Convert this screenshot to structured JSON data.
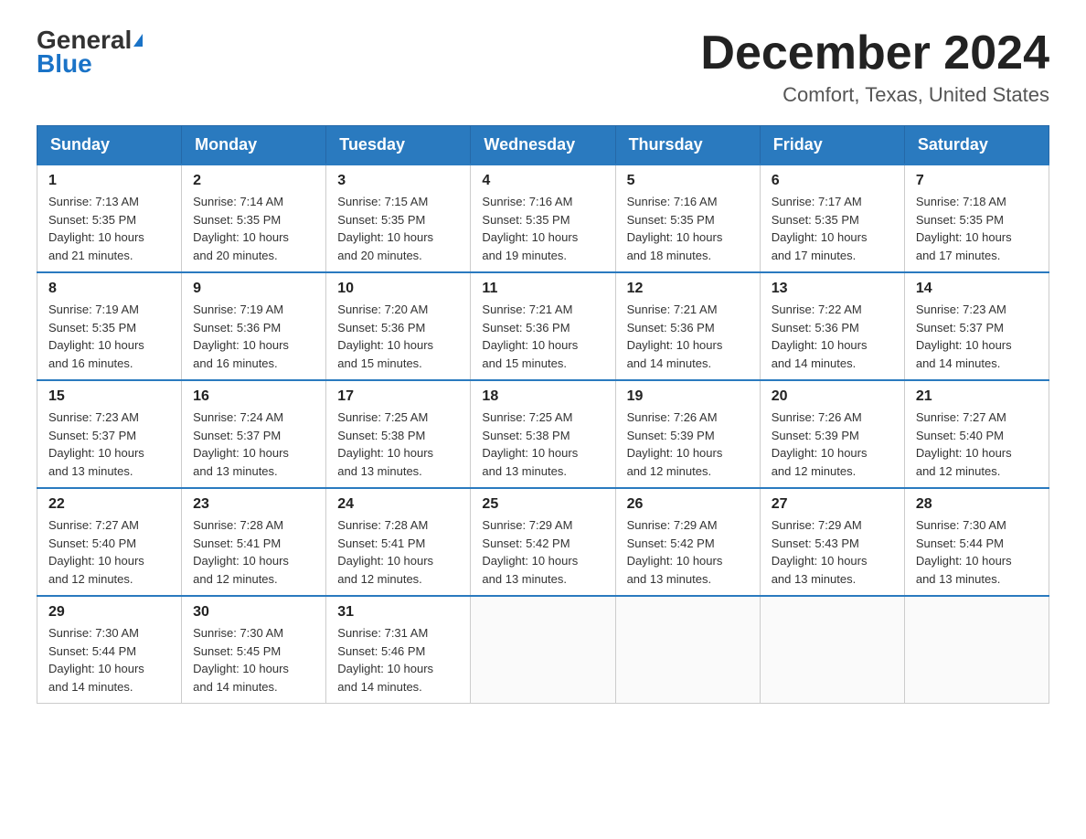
{
  "header": {
    "logo_general": "General",
    "logo_blue": "Blue",
    "month_title": "December 2024",
    "location": "Comfort, Texas, United States"
  },
  "days_of_week": [
    "Sunday",
    "Monday",
    "Tuesday",
    "Wednesday",
    "Thursday",
    "Friday",
    "Saturday"
  ],
  "weeks": [
    [
      {
        "day": "1",
        "sunrise": "7:13 AM",
        "sunset": "5:35 PM",
        "daylight": "10 hours and 21 minutes."
      },
      {
        "day": "2",
        "sunrise": "7:14 AM",
        "sunset": "5:35 PM",
        "daylight": "10 hours and 20 minutes."
      },
      {
        "day": "3",
        "sunrise": "7:15 AM",
        "sunset": "5:35 PM",
        "daylight": "10 hours and 20 minutes."
      },
      {
        "day": "4",
        "sunrise": "7:16 AM",
        "sunset": "5:35 PM",
        "daylight": "10 hours and 19 minutes."
      },
      {
        "day": "5",
        "sunrise": "7:16 AM",
        "sunset": "5:35 PM",
        "daylight": "10 hours and 18 minutes."
      },
      {
        "day": "6",
        "sunrise": "7:17 AM",
        "sunset": "5:35 PM",
        "daylight": "10 hours and 17 minutes."
      },
      {
        "day": "7",
        "sunrise": "7:18 AM",
        "sunset": "5:35 PM",
        "daylight": "10 hours and 17 minutes."
      }
    ],
    [
      {
        "day": "8",
        "sunrise": "7:19 AM",
        "sunset": "5:35 PM",
        "daylight": "10 hours and 16 minutes."
      },
      {
        "day": "9",
        "sunrise": "7:19 AM",
        "sunset": "5:36 PM",
        "daylight": "10 hours and 16 minutes."
      },
      {
        "day": "10",
        "sunrise": "7:20 AM",
        "sunset": "5:36 PM",
        "daylight": "10 hours and 15 minutes."
      },
      {
        "day": "11",
        "sunrise": "7:21 AM",
        "sunset": "5:36 PM",
        "daylight": "10 hours and 15 minutes."
      },
      {
        "day": "12",
        "sunrise": "7:21 AM",
        "sunset": "5:36 PM",
        "daylight": "10 hours and 14 minutes."
      },
      {
        "day": "13",
        "sunrise": "7:22 AM",
        "sunset": "5:36 PM",
        "daylight": "10 hours and 14 minutes."
      },
      {
        "day": "14",
        "sunrise": "7:23 AM",
        "sunset": "5:37 PM",
        "daylight": "10 hours and 14 minutes."
      }
    ],
    [
      {
        "day": "15",
        "sunrise": "7:23 AM",
        "sunset": "5:37 PM",
        "daylight": "10 hours and 13 minutes."
      },
      {
        "day": "16",
        "sunrise": "7:24 AM",
        "sunset": "5:37 PM",
        "daylight": "10 hours and 13 minutes."
      },
      {
        "day": "17",
        "sunrise": "7:25 AM",
        "sunset": "5:38 PM",
        "daylight": "10 hours and 13 minutes."
      },
      {
        "day": "18",
        "sunrise": "7:25 AM",
        "sunset": "5:38 PM",
        "daylight": "10 hours and 13 minutes."
      },
      {
        "day": "19",
        "sunrise": "7:26 AM",
        "sunset": "5:39 PM",
        "daylight": "10 hours and 12 minutes."
      },
      {
        "day": "20",
        "sunrise": "7:26 AM",
        "sunset": "5:39 PM",
        "daylight": "10 hours and 12 minutes."
      },
      {
        "day": "21",
        "sunrise": "7:27 AM",
        "sunset": "5:40 PM",
        "daylight": "10 hours and 12 minutes."
      }
    ],
    [
      {
        "day": "22",
        "sunrise": "7:27 AM",
        "sunset": "5:40 PM",
        "daylight": "10 hours and 12 minutes."
      },
      {
        "day": "23",
        "sunrise": "7:28 AM",
        "sunset": "5:41 PM",
        "daylight": "10 hours and 12 minutes."
      },
      {
        "day": "24",
        "sunrise": "7:28 AM",
        "sunset": "5:41 PM",
        "daylight": "10 hours and 12 minutes."
      },
      {
        "day": "25",
        "sunrise": "7:29 AM",
        "sunset": "5:42 PM",
        "daylight": "10 hours and 13 minutes."
      },
      {
        "day": "26",
        "sunrise": "7:29 AM",
        "sunset": "5:42 PM",
        "daylight": "10 hours and 13 minutes."
      },
      {
        "day": "27",
        "sunrise": "7:29 AM",
        "sunset": "5:43 PM",
        "daylight": "10 hours and 13 minutes."
      },
      {
        "day": "28",
        "sunrise": "7:30 AM",
        "sunset": "5:44 PM",
        "daylight": "10 hours and 13 minutes."
      }
    ],
    [
      {
        "day": "29",
        "sunrise": "7:30 AM",
        "sunset": "5:44 PM",
        "daylight": "10 hours and 14 minutes."
      },
      {
        "day": "30",
        "sunrise": "7:30 AM",
        "sunset": "5:45 PM",
        "daylight": "10 hours and 14 minutes."
      },
      {
        "day": "31",
        "sunrise": "7:31 AM",
        "sunset": "5:46 PM",
        "daylight": "10 hours and 14 minutes."
      },
      null,
      null,
      null,
      null
    ]
  ],
  "labels": {
    "sunrise": "Sunrise:",
    "sunset": "Sunset:",
    "daylight": "Daylight:"
  }
}
